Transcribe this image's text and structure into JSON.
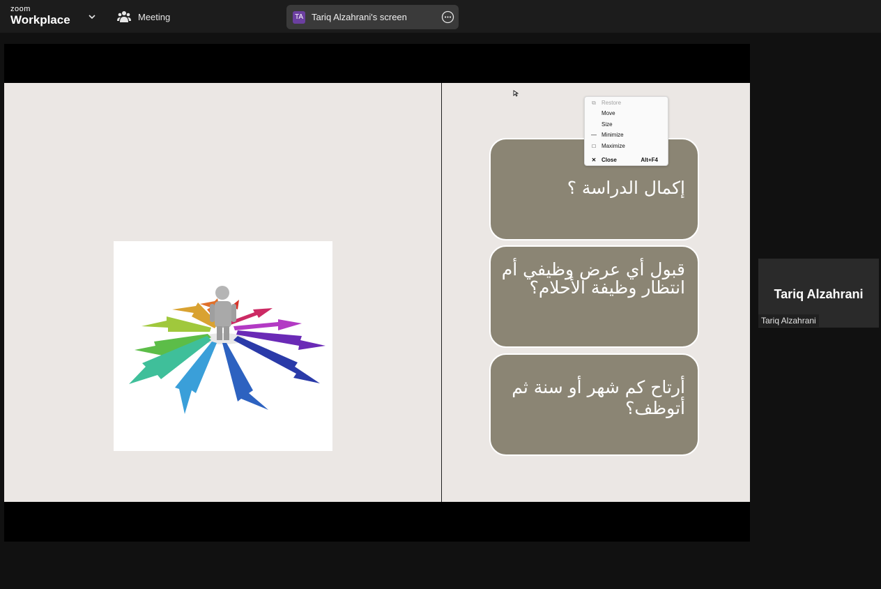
{
  "app": {
    "logo_small": "zoom",
    "logo_big": "Workplace"
  },
  "header": {
    "meeting_label": "Meeting",
    "screen_initials": "TA",
    "screen_title": "Tariq Alzahrani's screen"
  },
  "slide": {
    "cards": [
      "إكمال الدراسة ؟",
      "قبول أي عرض وظيفي أم انتظار وظيفة الأحلام؟",
      "أرتاح كم شهر أو سنة ثم أتوظف؟"
    ]
  },
  "context_menu": {
    "items": [
      {
        "label": "Restore",
        "disabled": true
      },
      {
        "label": "Move"
      },
      {
        "label": "Size"
      },
      {
        "label": "Minimize"
      },
      {
        "label": "Maximize"
      },
      {
        "label": "Close",
        "accelerator": "Alt+F4"
      }
    ]
  },
  "participant": {
    "display_name": "Tariq Alzahrani",
    "name_tag": "Tariq Alzahrani"
  },
  "colors": {
    "card_fill": "#8b8574",
    "slide_bg": "#ebe7e4",
    "avatar_purple": "#6b3fa0"
  }
}
